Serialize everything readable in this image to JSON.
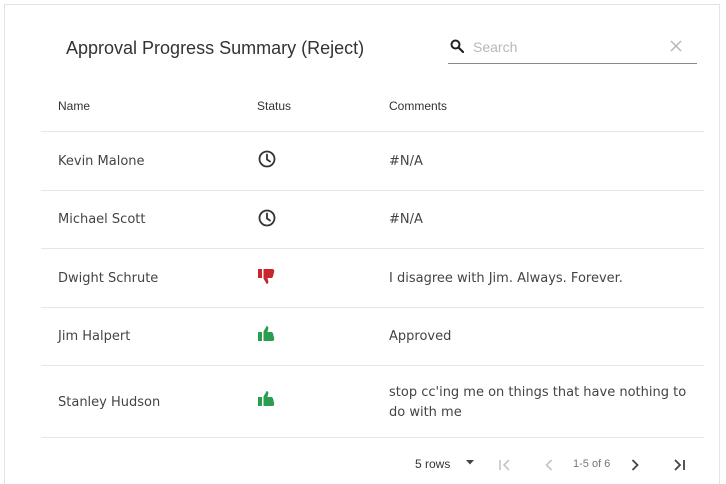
{
  "title": "Approval Progress Summary (Reject)",
  "search": {
    "placeholder": "Search",
    "value": ""
  },
  "columns": {
    "name": "Name",
    "status": "Status",
    "comments": "Comments"
  },
  "rows": [
    {
      "name": "Kevin Malone",
      "status": "pending",
      "comment": "#N/A"
    },
    {
      "name": "Michael Scott",
      "status": "pending",
      "comment": "#N/A"
    },
    {
      "name": "Dwight Schrute",
      "status": "rejected",
      "comment": "I disagree with Jim. Always. Forever."
    },
    {
      "name": "Jim Halpert",
      "status": "approved",
      "comment": "Approved"
    },
    {
      "name": "Stanley Hudson",
      "status": "approved",
      "comment": "stop cc'ing me on things that have nothing to do with me"
    }
  ],
  "status_icons": {
    "pending": "clock-icon",
    "rejected": "thumbs-down-icon",
    "approved": "thumbs-up-icon"
  },
  "colors": {
    "approved": "#2a9d4e",
    "rejected": "#c8262c",
    "pending": "#333333"
  },
  "pagination": {
    "rows_per_page": "5 rows",
    "range": "1-5 of 6"
  }
}
